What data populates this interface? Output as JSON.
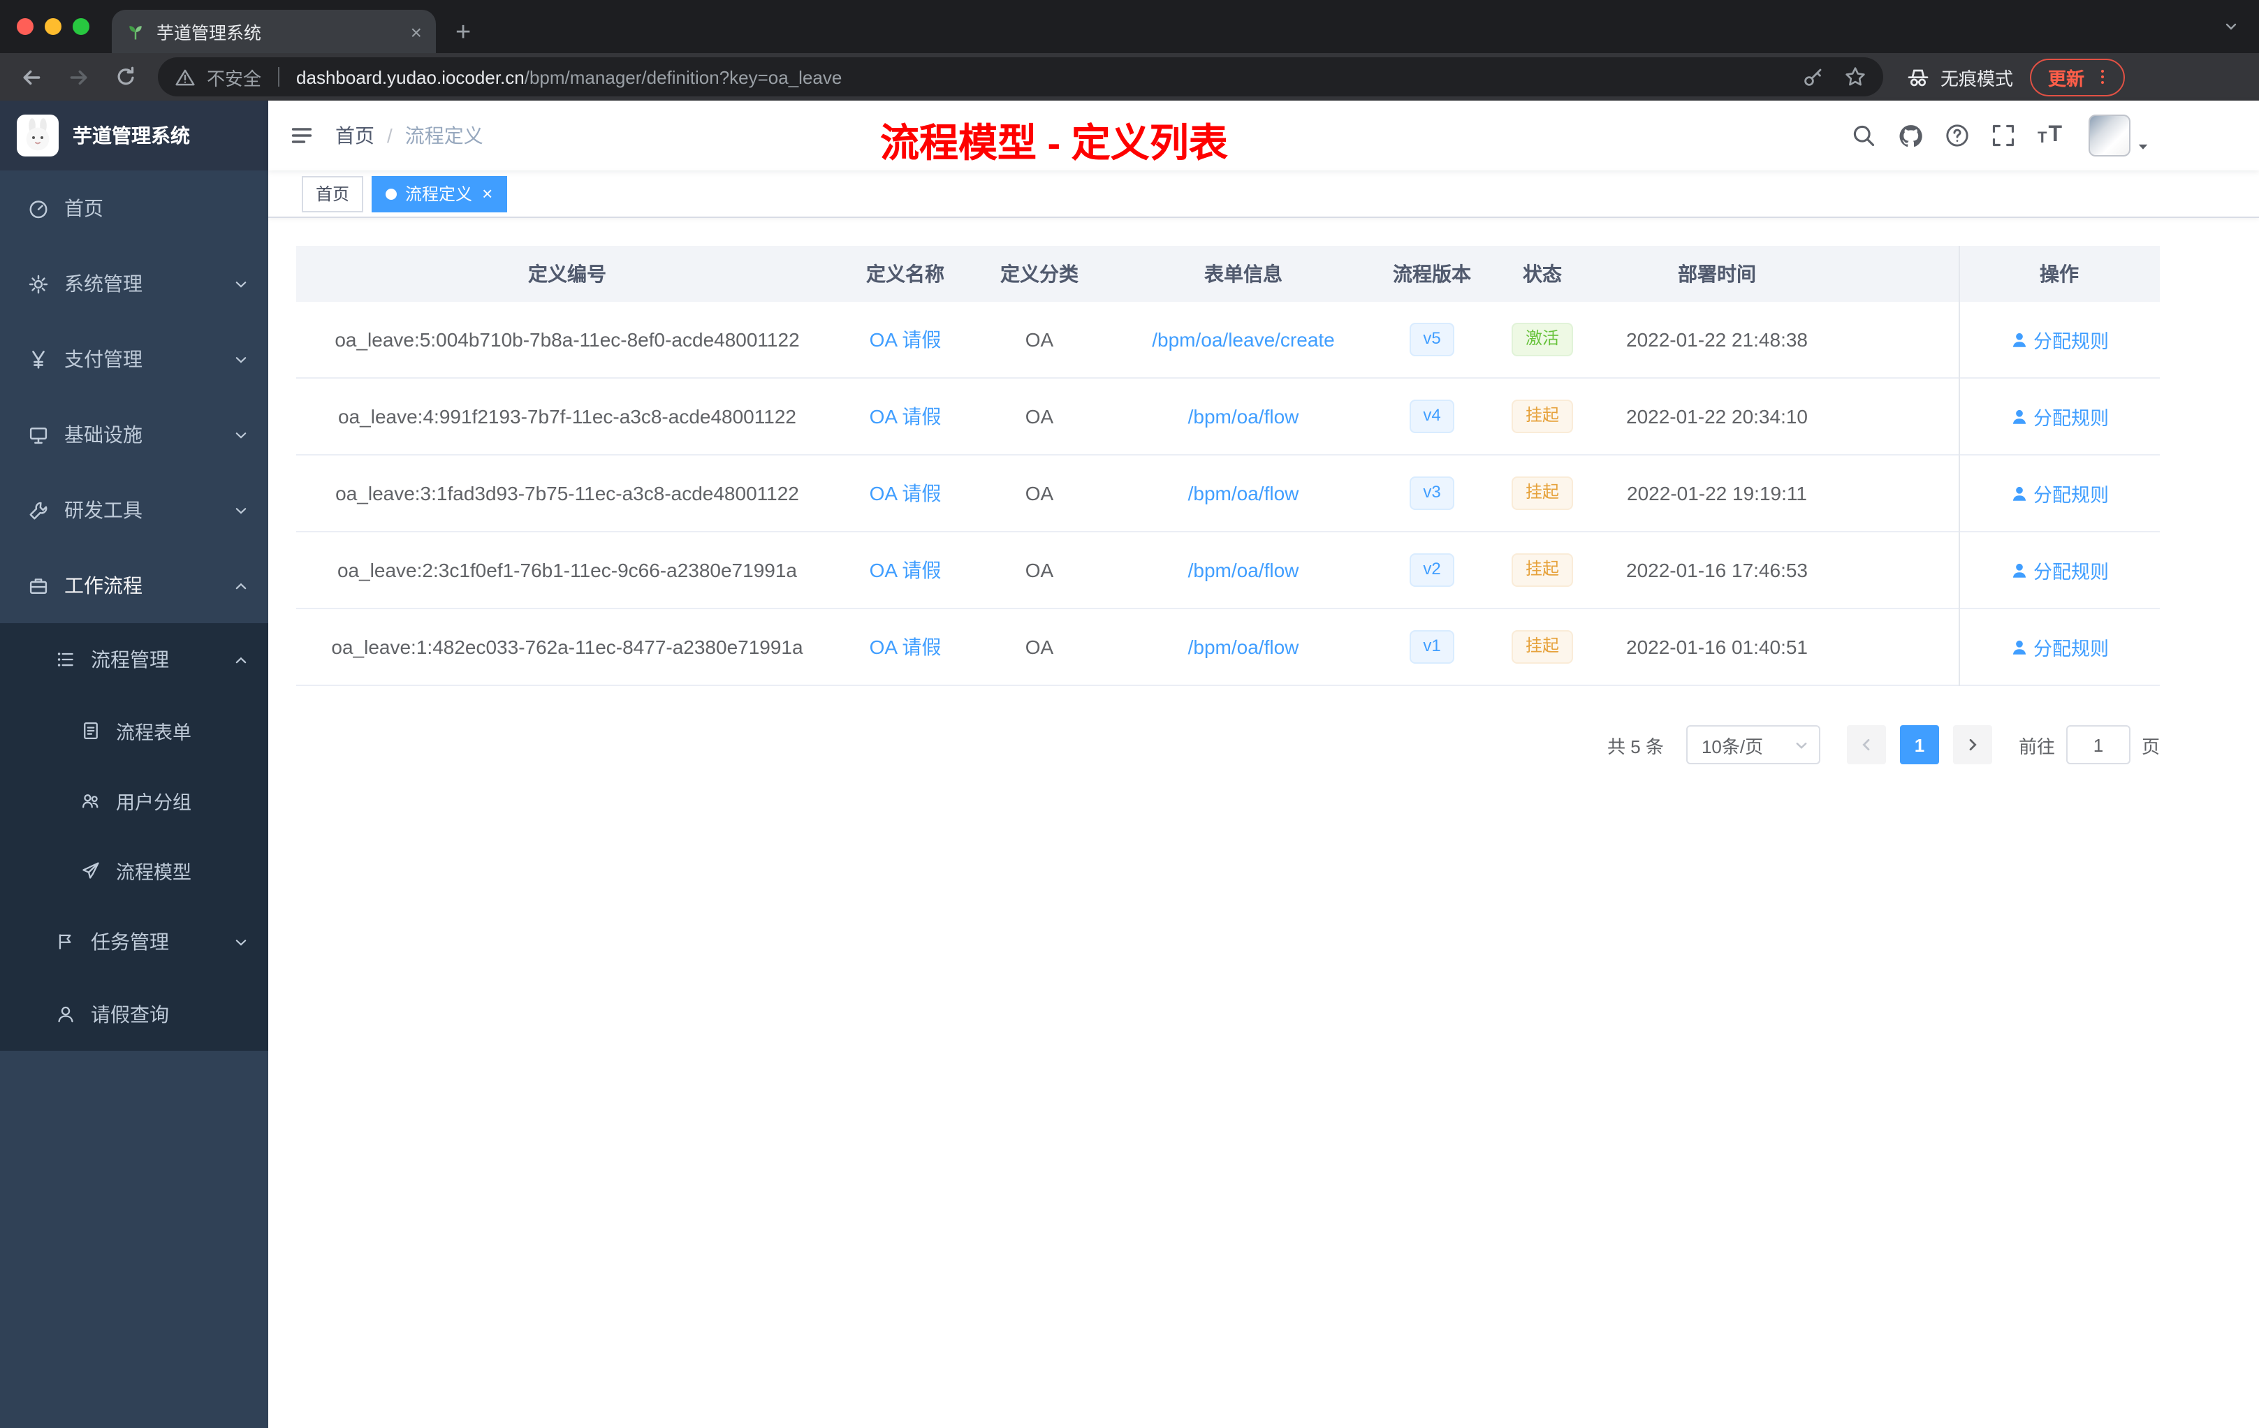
{
  "browser": {
    "tab_title": "芋道管理系统",
    "security_label": "不安全",
    "url_host": "dashboard.yudao.iocoder.cn",
    "url_path": "/bpm/manager/definition?key=oa_leave",
    "incognito_label": "无痕模式",
    "update_label": "更新"
  },
  "sidebar": {
    "logo_title": "芋道管理系统",
    "items": [
      {
        "label": "首页"
      },
      {
        "label": "系统管理"
      },
      {
        "label": "支付管理"
      },
      {
        "label": "基础设施"
      },
      {
        "label": "研发工具"
      },
      {
        "label": "工作流程"
      },
      {
        "label": "流程管理"
      },
      {
        "label": "流程表单"
      },
      {
        "label": "用户分组"
      },
      {
        "label": "流程模型"
      },
      {
        "label": "任务管理"
      },
      {
        "label": "请假查询"
      }
    ]
  },
  "navbar": {
    "breadcrumb_home": "首页",
    "breadcrumb_separator": "/",
    "breadcrumb_current": "流程定义",
    "annotation": "流程模型 - 定义列表"
  },
  "tags": {
    "home": "首页",
    "active": "流程定义"
  },
  "table": {
    "headers": {
      "id": "定义编号",
      "name": "定义名称",
      "category": "定义分类",
      "form": "表单信息",
      "version": "流程版本",
      "status": "状态",
      "deploy_time": "部署时间",
      "actions": "操作"
    },
    "rows": [
      {
        "id": "oa_leave:5:004b710b-7b8a-11ec-8ef0-acde48001122",
        "name": "OA 请假",
        "category": "OA",
        "form": "/bpm/oa/leave/create",
        "version": "v5",
        "status": "激活",
        "deploy_time": "2022-01-22 21:48:38",
        "action": "分配规则"
      },
      {
        "id": "oa_leave:4:991f2193-7b7f-11ec-a3c8-acde48001122",
        "name": "OA 请假",
        "category": "OA",
        "form": "/bpm/oa/flow",
        "version": "v4",
        "status": "挂起",
        "deploy_time": "2022-01-22 20:34:10",
        "action": "分配规则"
      },
      {
        "id": "oa_leave:3:1fad3d93-7b75-11ec-a3c8-acde48001122",
        "name": "OA 请假",
        "category": "OA",
        "form": "/bpm/oa/flow",
        "version": "v3",
        "status": "挂起",
        "deploy_time": "2022-01-22 19:19:11",
        "action": "分配规则"
      },
      {
        "id": "oa_leave:2:3c1f0ef1-76b1-11ec-9c66-a2380e71991a",
        "name": "OA 请假",
        "category": "OA",
        "form": "/bpm/oa/flow",
        "version": "v2",
        "status": "挂起",
        "deploy_time": "2022-01-16 17:46:53",
        "action": "分配规则"
      },
      {
        "id": "oa_leave:1:482ec033-762a-11ec-8477-a2380e71991a",
        "name": "OA 请假",
        "category": "OA",
        "form": "/bpm/oa/flow",
        "version": "v1",
        "status": "挂起",
        "deploy_time": "2022-01-16 01:40:51",
        "action": "分配规则"
      }
    ]
  },
  "pagination": {
    "total": "共 5 条",
    "page_size": "10条/页",
    "current_page": "1",
    "goto_label": "前往",
    "goto_value": "1",
    "page_unit": "页"
  },
  "colors": {
    "primary": "#409eff",
    "success": "#67c23a",
    "warning": "#e6a23c",
    "annotation": "#fe0100",
    "sidebar_bg": "#304156",
    "submenu_bg": "#1f2d3d"
  },
  "icons": {
    "favicon": "seedling",
    "security": "warning-triangle",
    "omnibox_right": [
      "key",
      "star"
    ],
    "navbar_right": [
      "search",
      "github",
      "question-circle",
      "fullscreen",
      "font-size"
    ],
    "action": "person"
  }
}
